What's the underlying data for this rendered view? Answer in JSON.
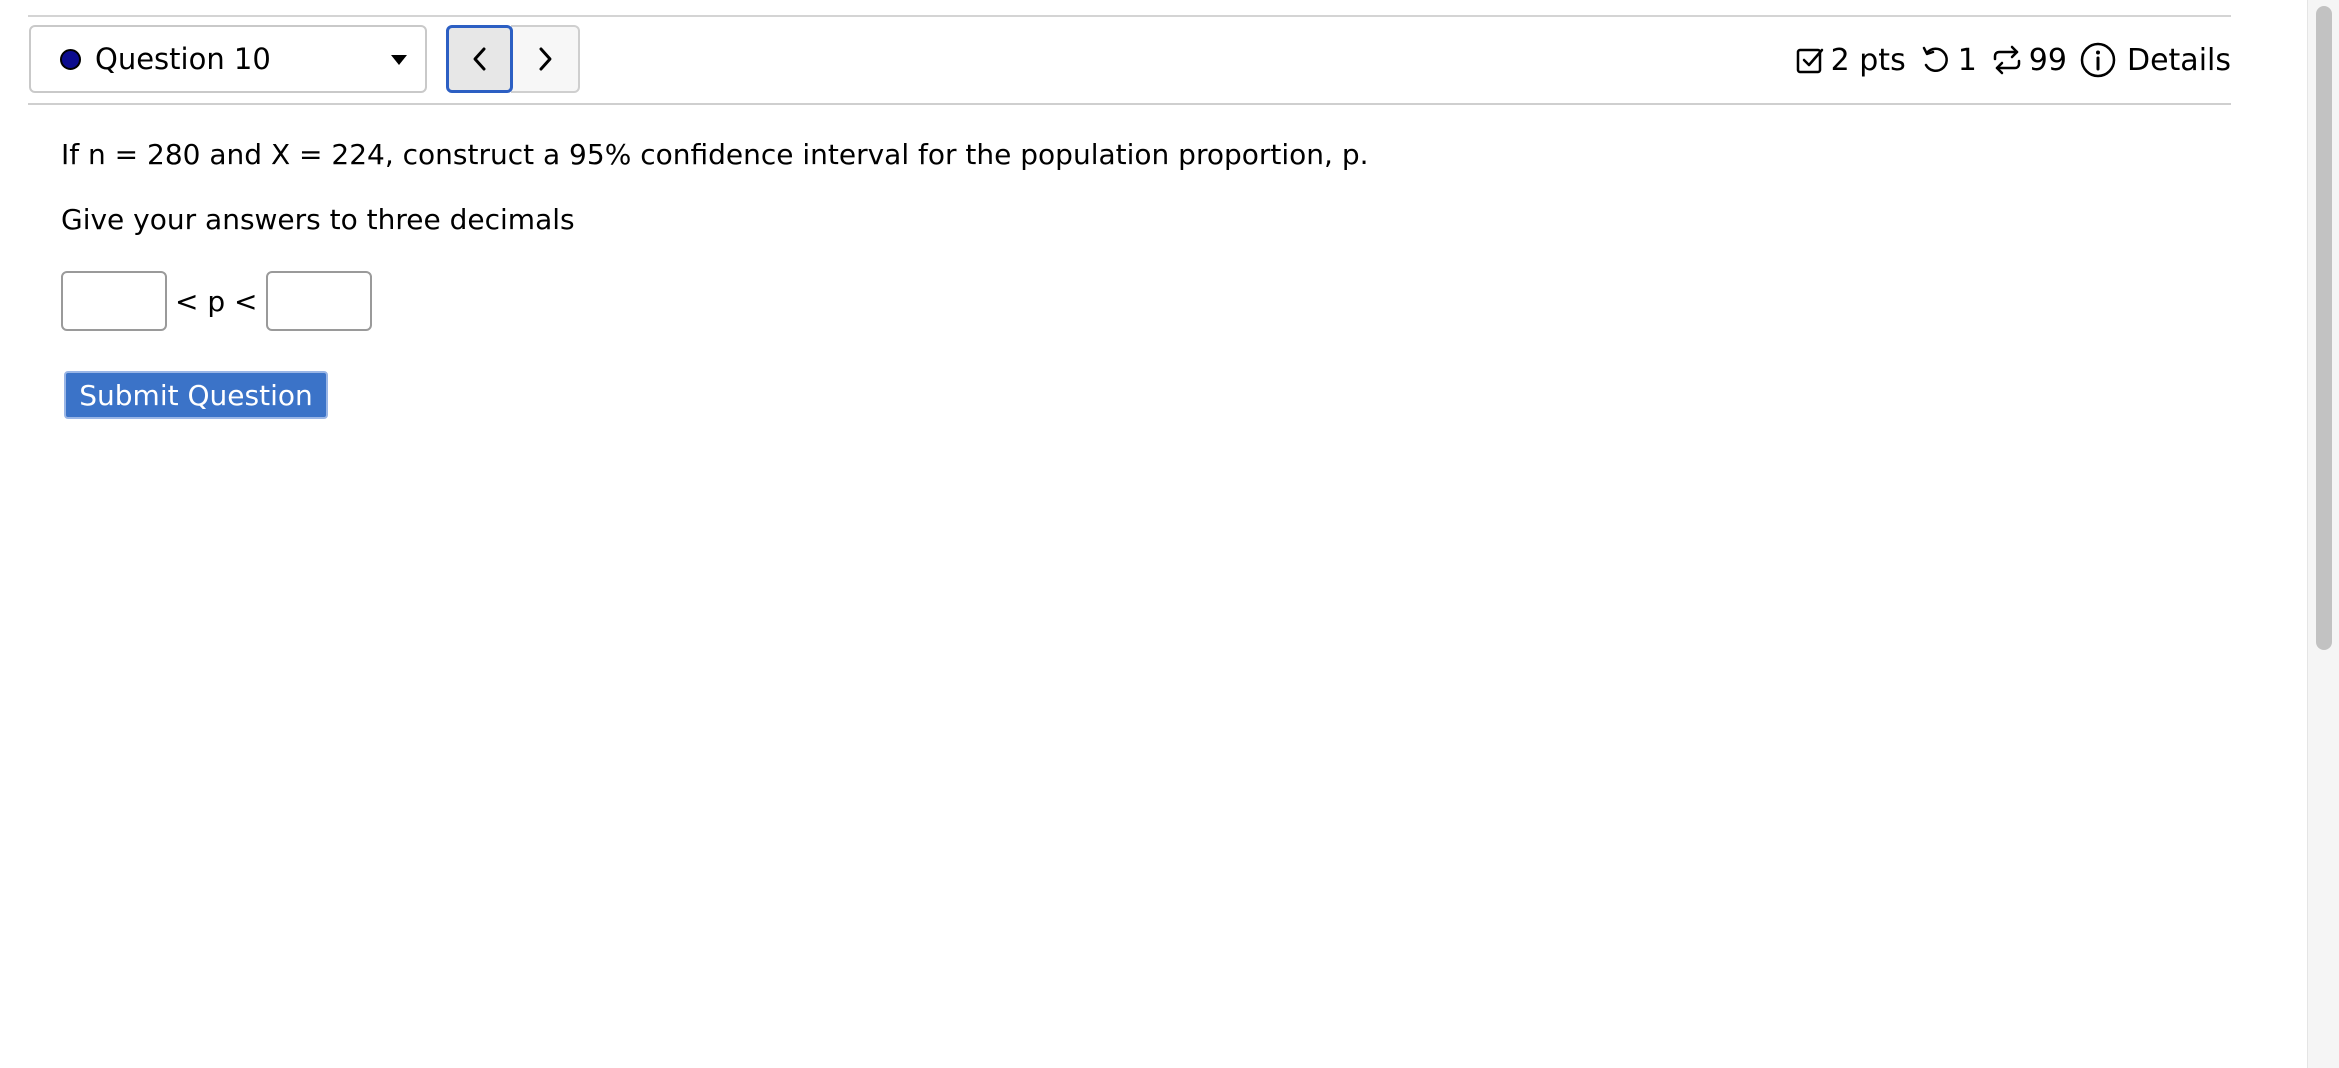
{
  "header": {
    "question_selector": {
      "label": "Question 10",
      "status_color": "#0b0b8e"
    },
    "nav": {
      "prev_icon": "chevron-left-icon",
      "next_icon": "chevron-right-icon"
    },
    "info": {
      "points": "2 pts",
      "retries": "1",
      "attempts": "99",
      "details_label": "Details"
    }
  },
  "question": {
    "text": "If n = 280 and X = 224, construct a 95% confidence interval for the population proportion, p.",
    "instruction": "Give your answers to three decimals",
    "answer": {
      "lower_value": "",
      "upper_value": "",
      "inequality": "< p <"
    },
    "submit_label": "Submit Question"
  },
  "colors": {
    "accent": "#3b73c8",
    "focus_border": "#2c5fc3"
  }
}
